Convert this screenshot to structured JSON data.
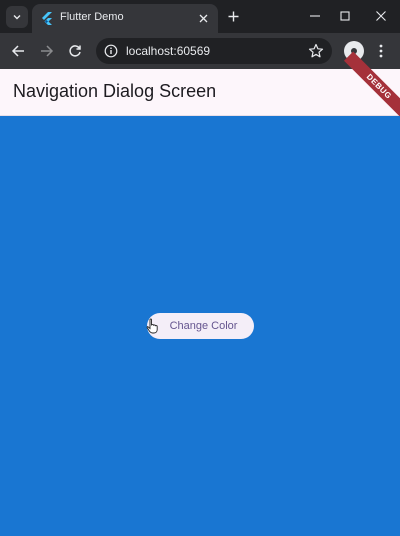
{
  "browser": {
    "tab": {
      "title": "Flutter Demo"
    },
    "address": {
      "url": "localhost:60569"
    }
  },
  "app": {
    "title": "Navigation Dialog Screen",
    "debug_banner": "DEBUG",
    "button": {
      "label": "Change Color"
    },
    "background_color": "#1976d2"
  },
  "icons": {
    "tab_search": "chevron-down-icon",
    "favicon": "flutter-logo-icon",
    "tab_close": "close-icon",
    "new_tab": "plus-icon",
    "minimize": "minimize-icon",
    "maximize": "maximize-icon",
    "close_window": "close-icon",
    "back": "arrow-left-icon",
    "forward": "arrow-right-icon",
    "reload": "reload-icon",
    "site_info": "info-icon",
    "bookmark": "star-icon",
    "profile": "person-icon",
    "menu": "more-vert-icon",
    "cursor": "hand-cursor-icon"
  }
}
